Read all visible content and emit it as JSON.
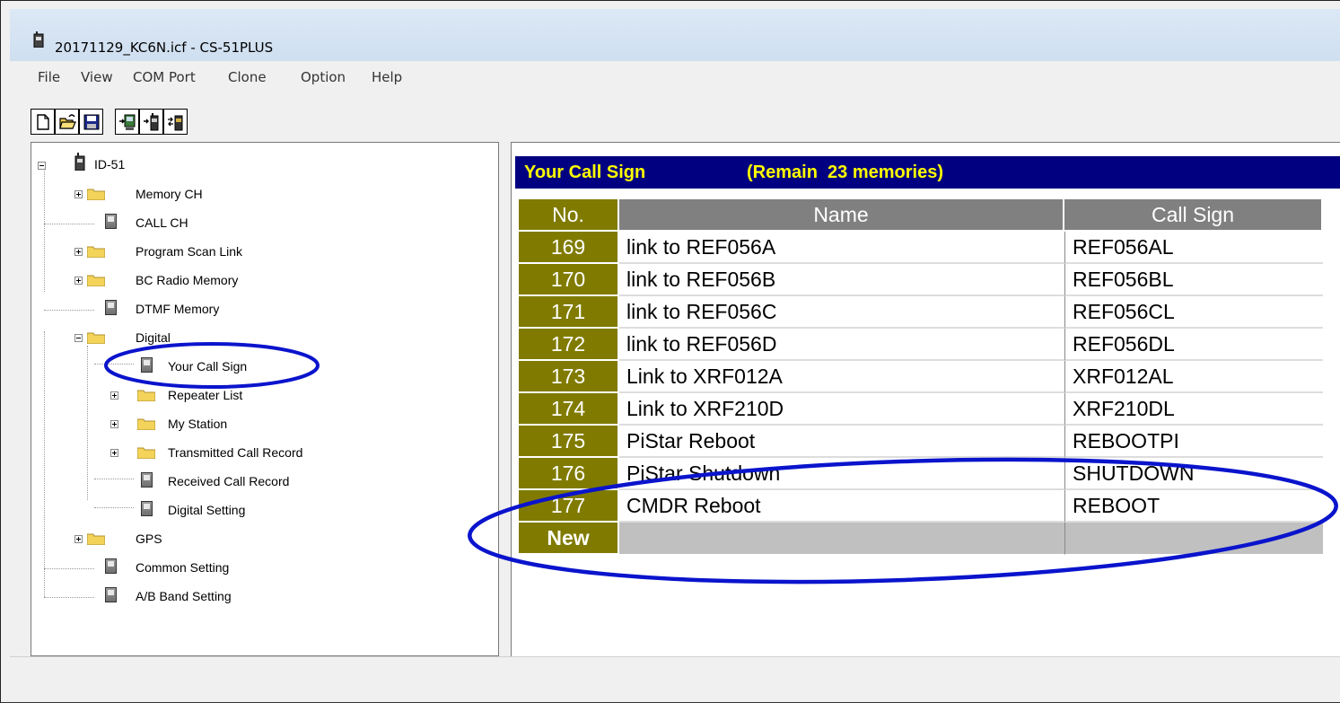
{
  "window": {
    "title": "20171129_KC6N.icf - CS-51PLUS",
    "app_icon": "radio-icon"
  },
  "menu": [
    "File",
    "View",
    "COM Port",
    "Clone",
    "Option",
    "Help"
  ],
  "toolbar": {
    "buttons": [
      {
        "name": "new-file-button",
        "icon": "new-document-icon"
      },
      {
        "name": "open-file-button",
        "icon": "open-folder-icon"
      },
      {
        "name": "save-file-button",
        "icon": "floppy-disk-icon"
      },
      {
        "name": "read-from-radio-button",
        "icon": "read-radio-icon"
      },
      {
        "name": "write-to-radio-button",
        "icon": "write-radio-icon"
      },
      {
        "name": "clone-radio-button",
        "icon": "clone-radio-icon"
      }
    ]
  },
  "tree": {
    "root": "ID-51",
    "nodes": [
      {
        "label": "Memory CH",
        "type": "folder",
        "expandable": true
      },
      {
        "label": "CALL CH",
        "type": "item",
        "expandable": false
      },
      {
        "label": "Program Scan Link",
        "type": "folder",
        "expandable": true
      },
      {
        "label": "BC Radio Memory",
        "type": "folder",
        "expandable": true
      },
      {
        "label": "DTMF Memory",
        "type": "item",
        "expandable": false
      },
      {
        "label": "Digital",
        "type": "folder",
        "expandable": true,
        "expanded": true
      },
      {
        "label": "Your Call Sign",
        "type": "item",
        "child": true,
        "selected": true
      },
      {
        "label": "Repeater List",
        "type": "folder",
        "child": true,
        "expandable": true
      },
      {
        "label": "My Station",
        "type": "folder",
        "child": true,
        "expandable": true
      },
      {
        "label": "Transmitted Call Record",
        "type": "folder",
        "child": true,
        "expandable": true
      },
      {
        "label": "Received Call Record",
        "type": "item",
        "child": true
      },
      {
        "label": "Digital Setting",
        "type": "item",
        "child": true
      },
      {
        "label": "GPS",
        "type": "folder",
        "expandable": true
      },
      {
        "label": "Common Setting",
        "type": "item"
      },
      {
        "label": "A/B Band Setting",
        "type": "item"
      }
    ]
  },
  "panel": {
    "title": "Your Call Sign",
    "remain": "(Remain  23 memories)",
    "columns": {
      "no": "No.",
      "name": "Name",
      "callsign": "Call Sign"
    },
    "rows": [
      {
        "no": "169",
        "name": "link to REF056A",
        "callsign": "REF056AL"
      },
      {
        "no": "170",
        "name": "link to REF056B",
        "callsign": "REF056BL"
      },
      {
        "no": "171",
        "name": "link to REF056C",
        "callsign": "REF056CL"
      },
      {
        "no": "172",
        "name": "link to REF056D",
        "callsign": "REF056DL"
      },
      {
        "no": "173",
        "name": "Link to XRF012A",
        "callsign": "XRF012AL"
      },
      {
        "no": "174",
        "name": "Link to XRF210D",
        "callsign": "XRF210DL"
      },
      {
        "no": "175",
        "name": "PiStar Reboot",
        "callsign": "REBOOTPI"
      },
      {
        "no": "176",
        "name": "PiStar Shutdown",
        "callsign": "SHUTDOWN"
      },
      {
        "no": "177",
        "name": "CMDR Reboot",
        "callsign": "REBOOT"
      }
    ],
    "new_row_label": "New"
  },
  "colors": {
    "header_bg": "#000080",
    "header_text": "#ffff00",
    "no_cell_bg": "#807b00",
    "col_header_bg": "#808080",
    "annotation": "#0a14cc"
  },
  "annotations": [
    "highlight-ellipse-your-call-sign",
    "highlight-ellipse-rows-175-176"
  ]
}
